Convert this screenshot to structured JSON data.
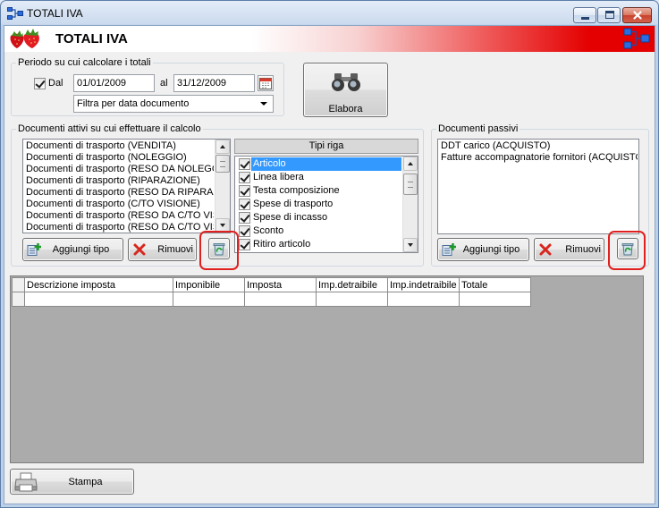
{
  "window": {
    "title": "TOTALI IVA"
  },
  "header": {
    "title": "TOTALI IVA"
  },
  "period": {
    "legend": "Periodo su cui calcolare i totali",
    "dal_label": "Dal",
    "dal_checked": true,
    "from_date": "01/01/2009",
    "al_label": "al",
    "to_date": "31/12/2009",
    "filter_selected": "Filtra per data documento"
  },
  "elabora": {
    "label": "Elabora"
  },
  "attivi": {
    "legend": "Documenti attivi su cui effettuare il calcolo",
    "items": [
      "Documenti di trasporto (VENDITA)",
      "Documenti di trasporto (NOLEGGIO)",
      "Documenti di trasporto (RESO DA NOLEGGI",
      "Documenti di trasporto (RIPARAZIONE)",
      "Documenti di trasporto (RESO DA RIPARAZI",
      "Documenti di trasporto (C/TO VISIONE)",
      "Documenti di trasporto (RESO DA C/TO VISI",
      "Documenti di trasporto (RESO DA C/TO VIS"
    ],
    "add_label": "Aggiungi tipo",
    "remove_label": "Rimuovi"
  },
  "tipi_riga": {
    "header": "Tipi riga",
    "items": [
      {
        "label": "Articolo",
        "checked": true,
        "selected": true
      },
      {
        "label": "Linea libera",
        "checked": true,
        "selected": false
      },
      {
        "label": "Testa composizione",
        "checked": true,
        "selected": false
      },
      {
        "label": "Spese di trasporto",
        "checked": true,
        "selected": false
      },
      {
        "label": "Spese di incasso",
        "checked": true,
        "selected": false
      },
      {
        "label": "Sconto",
        "checked": true,
        "selected": false
      },
      {
        "label": "Ritiro articolo",
        "checked": true,
        "selected": false
      }
    ]
  },
  "passivi": {
    "legend": "Documenti passivi",
    "items": [
      "DDT carico (ACQUISTO)",
      "Fatture accompagnatorie fornitori (ACQUISTO)"
    ],
    "add_label": "Aggiungi tipo",
    "remove_label": "Rimuovi"
  },
  "grid": {
    "columns": [
      "Descrizione imposta",
      "Imponibile",
      "Imposta",
      "Imp.detraibile",
      "Imp.indetraibile",
      "Totale"
    ]
  },
  "footer": {
    "print_label": "Stampa"
  },
  "icons": {
    "window": "network-icon",
    "header_left": "strawberry-icon",
    "header_right": "network-icon",
    "elabora": "binoculars-icon",
    "date_picker": "calendar-icon",
    "add": "add-icon",
    "remove": "remove-icon",
    "empty_list": "recycle-bin-icon",
    "print": "printer-icon"
  },
  "colors": {
    "header_red": "#e40000",
    "selection": "#3399ff",
    "annotation": "#e0201e",
    "grid_background": "#ababab"
  }
}
